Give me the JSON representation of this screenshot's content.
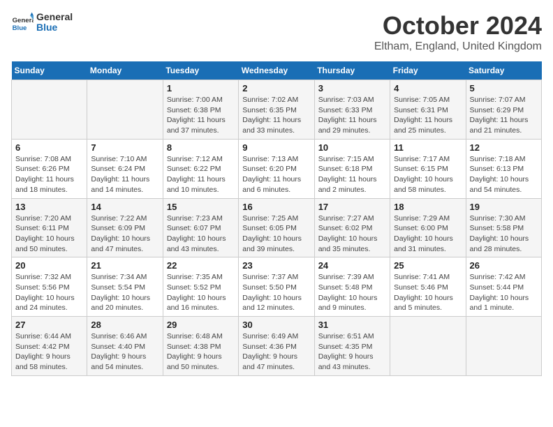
{
  "header": {
    "logo": {
      "general": "General",
      "blue": "Blue"
    },
    "title": "October 2024",
    "location": "Eltham, England, United Kingdom"
  },
  "days_of_week": [
    "Sunday",
    "Monday",
    "Tuesday",
    "Wednesday",
    "Thursday",
    "Friday",
    "Saturday"
  ],
  "weeks": [
    [
      {
        "day": "",
        "info": ""
      },
      {
        "day": "",
        "info": ""
      },
      {
        "day": "1",
        "info": "Sunrise: 7:00 AM\nSunset: 6:38 PM\nDaylight: 11 hours and 37 minutes."
      },
      {
        "day": "2",
        "info": "Sunrise: 7:02 AM\nSunset: 6:35 PM\nDaylight: 11 hours and 33 minutes."
      },
      {
        "day": "3",
        "info": "Sunrise: 7:03 AM\nSunset: 6:33 PM\nDaylight: 11 hours and 29 minutes."
      },
      {
        "day": "4",
        "info": "Sunrise: 7:05 AM\nSunset: 6:31 PM\nDaylight: 11 hours and 25 minutes."
      },
      {
        "day": "5",
        "info": "Sunrise: 7:07 AM\nSunset: 6:29 PM\nDaylight: 11 hours and 21 minutes."
      }
    ],
    [
      {
        "day": "6",
        "info": "Sunrise: 7:08 AM\nSunset: 6:26 PM\nDaylight: 11 hours and 18 minutes."
      },
      {
        "day": "7",
        "info": "Sunrise: 7:10 AM\nSunset: 6:24 PM\nDaylight: 11 hours and 14 minutes."
      },
      {
        "day": "8",
        "info": "Sunrise: 7:12 AM\nSunset: 6:22 PM\nDaylight: 11 hours and 10 minutes."
      },
      {
        "day": "9",
        "info": "Sunrise: 7:13 AM\nSunset: 6:20 PM\nDaylight: 11 hours and 6 minutes."
      },
      {
        "day": "10",
        "info": "Sunrise: 7:15 AM\nSunset: 6:18 PM\nDaylight: 11 hours and 2 minutes."
      },
      {
        "day": "11",
        "info": "Sunrise: 7:17 AM\nSunset: 6:15 PM\nDaylight: 10 hours and 58 minutes."
      },
      {
        "day": "12",
        "info": "Sunrise: 7:18 AM\nSunset: 6:13 PM\nDaylight: 10 hours and 54 minutes."
      }
    ],
    [
      {
        "day": "13",
        "info": "Sunrise: 7:20 AM\nSunset: 6:11 PM\nDaylight: 10 hours and 50 minutes."
      },
      {
        "day": "14",
        "info": "Sunrise: 7:22 AM\nSunset: 6:09 PM\nDaylight: 10 hours and 47 minutes."
      },
      {
        "day": "15",
        "info": "Sunrise: 7:23 AM\nSunset: 6:07 PM\nDaylight: 10 hours and 43 minutes."
      },
      {
        "day": "16",
        "info": "Sunrise: 7:25 AM\nSunset: 6:05 PM\nDaylight: 10 hours and 39 minutes."
      },
      {
        "day": "17",
        "info": "Sunrise: 7:27 AM\nSunset: 6:02 PM\nDaylight: 10 hours and 35 minutes."
      },
      {
        "day": "18",
        "info": "Sunrise: 7:29 AM\nSunset: 6:00 PM\nDaylight: 10 hours and 31 minutes."
      },
      {
        "day": "19",
        "info": "Sunrise: 7:30 AM\nSunset: 5:58 PM\nDaylight: 10 hours and 28 minutes."
      }
    ],
    [
      {
        "day": "20",
        "info": "Sunrise: 7:32 AM\nSunset: 5:56 PM\nDaylight: 10 hours and 24 minutes."
      },
      {
        "day": "21",
        "info": "Sunrise: 7:34 AM\nSunset: 5:54 PM\nDaylight: 10 hours and 20 minutes."
      },
      {
        "day": "22",
        "info": "Sunrise: 7:35 AM\nSunset: 5:52 PM\nDaylight: 10 hours and 16 minutes."
      },
      {
        "day": "23",
        "info": "Sunrise: 7:37 AM\nSunset: 5:50 PM\nDaylight: 10 hours and 12 minutes."
      },
      {
        "day": "24",
        "info": "Sunrise: 7:39 AM\nSunset: 5:48 PM\nDaylight: 10 hours and 9 minutes."
      },
      {
        "day": "25",
        "info": "Sunrise: 7:41 AM\nSunset: 5:46 PM\nDaylight: 10 hours and 5 minutes."
      },
      {
        "day": "26",
        "info": "Sunrise: 7:42 AM\nSunset: 5:44 PM\nDaylight: 10 hours and 1 minute."
      }
    ],
    [
      {
        "day": "27",
        "info": "Sunrise: 6:44 AM\nSunset: 4:42 PM\nDaylight: 9 hours and 58 minutes."
      },
      {
        "day": "28",
        "info": "Sunrise: 6:46 AM\nSunset: 4:40 PM\nDaylight: 9 hours and 54 minutes."
      },
      {
        "day": "29",
        "info": "Sunrise: 6:48 AM\nSunset: 4:38 PM\nDaylight: 9 hours and 50 minutes."
      },
      {
        "day": "30",
        "info": "Sunrise: 6:49 AM\nSunset: 4:36 PM\nDaylight: 9 hours and 47 minutes."
      },
      {
        "day": "31",
        "info": "Sunrise: 6:51 AM\nSunset: 4:35 PM\nDaylight: 9 hours and 43 minutes."
      },
      {
        "day": "",
        "info": ""
      },
      {
        "day": "",
        "info": ""
      }
    ]
  ]
}
